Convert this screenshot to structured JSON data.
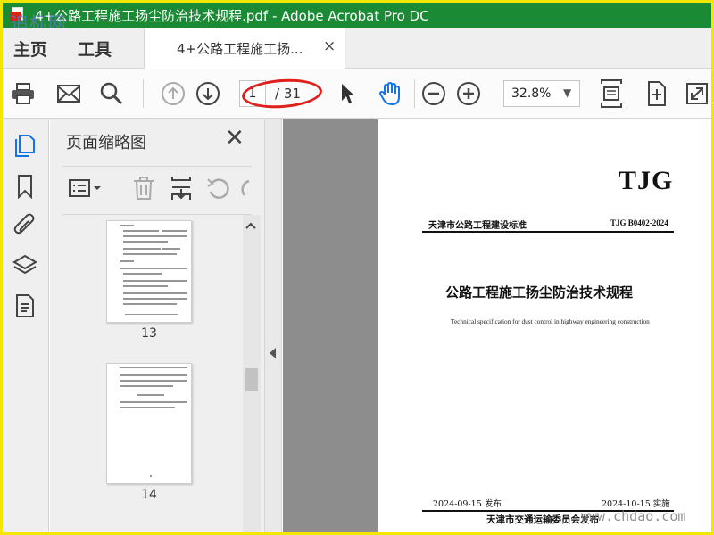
{
  "window": {
    "title": "4+公路工程施工扬尘防治技术规程.pdf - Adobe Acrobat Pro DC",
    "titlebar_color": "#1a8a34",
    "frame_color": "#f2e700"
  },
  "nav": {
    "home": "主页",
    "tools": "工具",
    "tab_label": "4+公路工程施工扬...",
    "tab_close": "×"
  },
  "toolbar": {
    "current_page": "1",
    "total_pages": "/ 31",
    "zoom": "32.8%",
    "zoom_caret": "▼",
    "icons": [
      "print-icon",
      "email-icon",
      "search-icon",
      "page-up-icon",
      "page-down-icon",
      "select-cursor-icon",
      "hand-tool-icon",
      "zoom-out-icon",
      "zoom-in-icon",
      "fit-page-icon",
      "rotate-icon",
      "fullscreen-icon"
    ]
  },
  "sidebar": {
    "icons": [
      "page-thumbnails-icon",
      "bookmark-icon",
      "attachment-icon",
      "layers-icon",
      "document-properties-icon"
    ]
  },
  "thumbnail_panel": {
    "title": "页面缩略图",
    "close": "✕",
    "thumbnails": [
      {
        "label": "13"
      },
      {
        "label": "14"
      }
    ]
  },
  "document": {
    "logo": "TJG",
    "standard_name": "天津市公路工程建设标准",
    "standard_code": "TJG B0402-2024",
    "title": "公路工程施工扬尘防治技术规程",
    "subtitle": "Technical specification for dust control in highway engineering construction",
    "publish_date": "2024-09-15 发布",
    "implement_date": "2024-10-15 实施",
    "issuer": "天津市交通运输委员会发布"
  },
  "watermarks": {
    "top_left": "追标网",
    "bottom_right": "www.chdao.com"
  }
}
